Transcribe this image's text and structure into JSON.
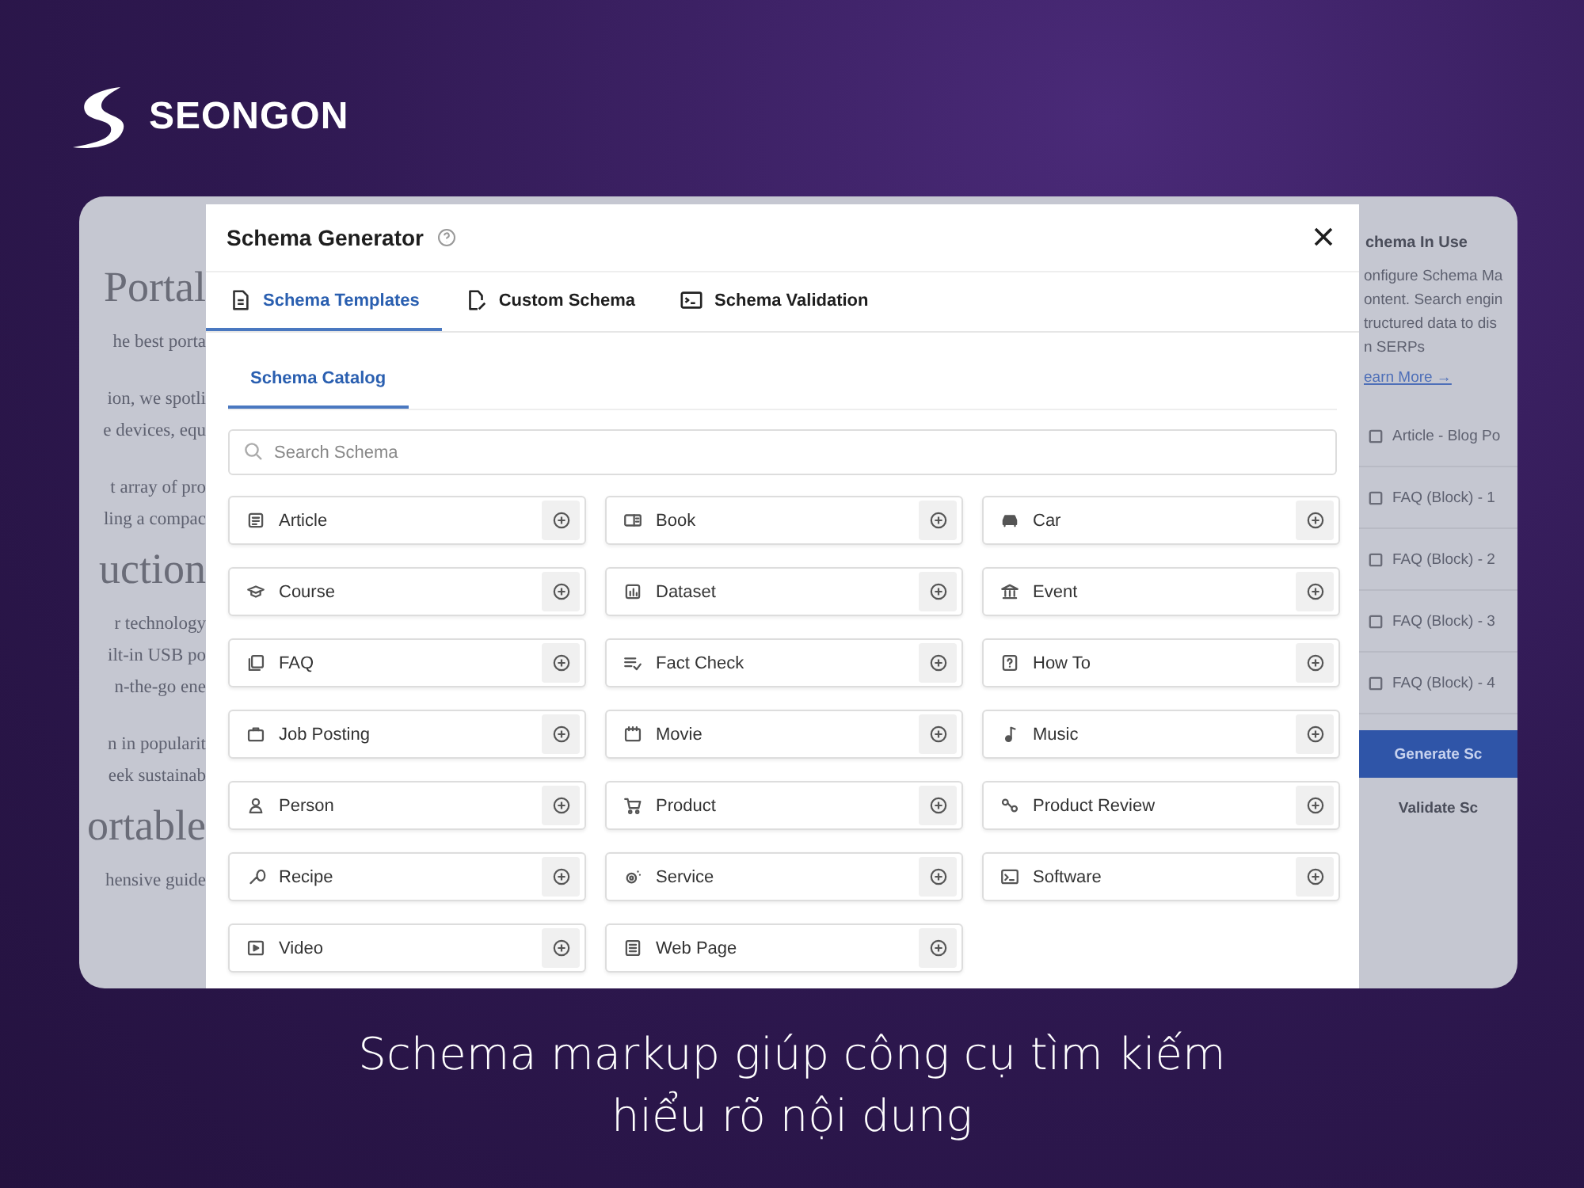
{
  "brand": {
    "name": "SEONGON"
  },
  "background_page": {
    "left_lines": [
      {
        "kind": "heading",
        "text": "Portal"
      },
      {
        "kind": "text",
        "text": "he best porta"
      },
      {
        "kind": "gap",
        "text": "ion, we spotli"
      },
      {
        "kind": "text",
        "text": "e devices, equ"
      },
      {
        "kind": "gap",
        "text": "t array of pro"
      },
      {
        "kind": "text",
        "text": "ling a compac"
      },
      {
        "kind": "heading",
        "text": "uction"
      },
      {
        "kind": "text",
        "text": "r technology"
      },
      {
        "kind": "text",
        "text": "ilt-in USB po"
      },
      {
        "kind": "text",
        "text": "n-the-go ene"
      },
      {
        "kind": "gap",
        "text": "n in popularit"
      },
      {
        "kind": "text",
        "text": "eek sustainab"
      },
      {
        "kind": "heading",
        "text": "ortable"
      },
      {
        "kind": "text",
        "text": "hensive guide"
      }
    ],
    "right_panel": {
      "heading": "chema In Use",
      "description": [
        "onfigure Schema Ma",
        "ontent. Search engin",
        "tructured data to dis",
        "n SERPs"
      ],
      "link": "earn More →",
      "items": [
        "Article - Blog Po",
        "FAQ (Block) - 1",
        "FAQ (Block) - 2",
        "FAQ (Block) - 3",
        "FAQ (Block) - 4"
      ],
      "buttons": [
        {
          "label": "Generate Sc",
          "kind": "primary"
        },
        {
          "label": "Validate Sc",
          "kind": "secondary"
        }
      ]
    }
  },
  "modal": {
    "title": "Schema Generator",
    "tabs": [
      {
        "label": "Schema Templates",
        "selected": true
      },
      {
        "label": "Custom Schema",
        "selected": false
      },
      {
        "label": "Schema Validation",
        "selected": false
      }
    ],
    "subtabs": [
      {
        "label": "Schema Catalog",
        "selected": true
      }
    ],
    "search": {
      "placeholder": "Search Schema"
    },
    "templates": [
      {
        "label": "Article"
      },
      {
        "label": "Book"
      },
      {
        "label": "Car"
      },
      {
        "label": "Course"
      },
      {
        "label": "Dataset"
      },
      {
        "label": "Event"
      },
      {
        "label": "FAQ"
      },
      {
        "label": "Fact Check"
      },
      {
        "label": "How To"
      },
      {
        "label": "Job Posting"
      },
      {
        "label": "Movie"
      },
      {
        "label": "Music"
      },
      {
        "label": "Person"
      },
      {
        "label": "Product"
      },
      {
        "label": "Product Review"
      },
      {
        "label": "Recipe"
      },
      {
        "label": "Service"
      },
      {
        "label": "Software"
      },
      {
        "label": "Video"
      },
      {
        "label": "Web Page"
      }
    ]
  },
  "caption": "Schema markup giúp công cụ tìm kiếm\nhiểu rõ nội dung"
}
